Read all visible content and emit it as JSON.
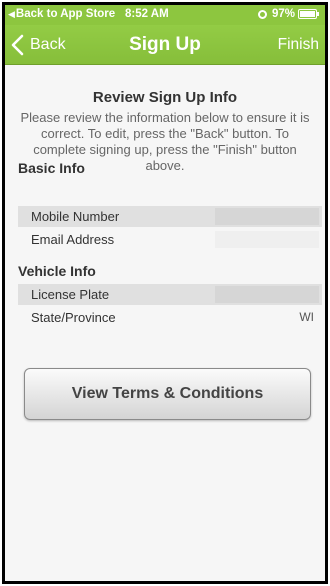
{
  "status_bar": {
    "back_to_app": "Back to App Store",
    "time": "8:52 AM",
    "battery": "97%"
  },
  "nav": {
    "back_label": "Back",
    "title": "Sign Up",
    "finish_label": "Finish"
  },
  "review": {
    "title": "Review Sign Up Info",
    "description": "Please review the information below to ensure it is correct. To edit, press the \"Back\" button. To complete signing up, press the \"Finish\" button above."
  },
  "basic_info": {
    "header": "Basic Info",
    "rows": [
      {
        "label": "Mobile Number",
        "value": ""
      },
      {
        "label": "Email Address",
        "value": ""
      }
    ]
  },
  "vehicle_info": {
    "header": "Vehicle Info",
    "rows": [
      {
        "label": "License Plate",
        "value": ""
      },
      {
        "label": "State/Province",
        "value": "WI"
      }
    ]
  },
  "terms_button_label": "View Terms & Conditions",
  "colors": {
    "accent_green": "#8dc63f",
    "background": "#f6f6f6"
  }
}
